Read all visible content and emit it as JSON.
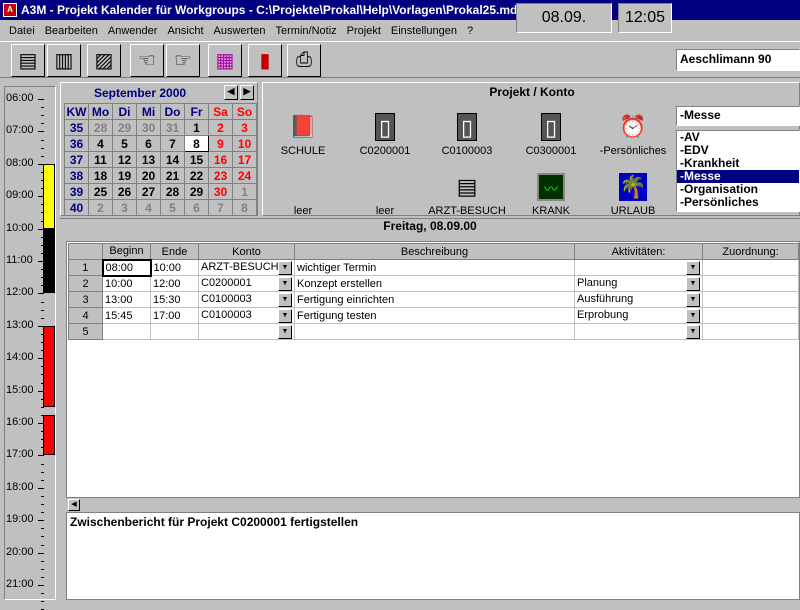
{
  "window": {
    "title": "A3M - Projekt Kalender für Workgroups - C:\\Projekte\\Prokal\\Help\\Vorlagen\\Prokal25.mdb"
  },
  "menu": [
    "Datei",
    "Bearbeiten",
    "Anwender",
    "Ansicht",
    "Auswerten",
    "Termin/Notiz",
    "Projekt",
    "Einstellungen",
    "?"
  ],
  "toolbar": {
    "buttons": [
      "notepad-icon",
      "book-icon",
      "grid-cross-icon",
      "hand-card-icon",
      "pointing-hand-icon",
      "color-grid-icon",
      "chart-icon",
      "printer-icon"
    ],
    "date": "08.09.",
    "time": "12:05",
    "user": "Aeschlimann 90"
  },
  "timeline": {
    "hours": [
      "06:00",
      "07:00",
      "08:00",
      "09:00",
      "10:00",
      "11:00",
      "12:00",
      "13:00",
      "14:00",
      "15:00",
      "16:00",
      "17:00",
      "18:00",
      "19:00",
      "20:00",
      "21:00"
    ],
    "blocks": [
      {
        "from": 8.0,
        "to": 10.0,
        "color": "#ffff00"
      },
      {
        "from": 10.0,
        "to": 12.0,
        "color": "#000000"
      },
      {
        "from": 13.0,
        "to": 15.5,
        "color": "#ff0000"
      },
      {
        "from": 15.75,
        "to": 17.0,
        "color": "#ff0000"
      }
    ]
  },
  "calendar": {
    "month": "September 2000",
    "prev": "◀",
    "next": "▶",
    "headers": [
      "KW",
      "Mo",
      "Di",
      "Mi",
      "Do",
      "Fr",
      "Sa",
      "So"
    ],
    "weeks": [
      {
        "kw": "35",
        "days": [
          "28",
          "29",
          "30",
          "31",
          "1",
          "2",
          "3"
        ]
      },
      {
        "kw": "36",
        "days": [
          "4",
          "5",
          "6",
          "7",
          "8",
          "9",
          "10"
        ]
      },
      {
        "kw": "37",
        "days": [
          "11",
          "12",
          "13",
          "14",
          "15",
          "16",
          "17"
        ]
      },
      {
        "kw": "38",
        "days": [
          "18",
          "19",
          "20",
          "21",
          "22",
          "23",
          "24"
        ]
      },
      {
        "kw": "39",
        "days": [
          "25",
          "26",
          "27",
          "28",
          "29",
          "30",
          "1"
        ]
      },
      {
        "kw": "40",
        "days": [
          "2",
          "3",
          "4",
          "5",
          "6",
          "7",
          "8"
        ]
      }
    ]
  },
  "projects": {
    "title": "Projekt / Konto",
    "items": [
      {
        "label": "SCHULE",
        "icon": "red-book-icon"
      },
      {
        "label": "C0200001",
        "icon": "notebook-icon"
      },
      {
        "label": "C0100003",
        "icon": "notebook-icon"
      },
      {
        "label": "C0300001",
        "icon": "notebook-icon"
      },
      {
        "label": "-Persönliches",
        "icon": "alarm-clock-icon"
      },
      {
        "label": "leer",
        "icon": ""
      },
      {
        "label": "leer",
        "icon": ""
      },
      {
        "label": "ARZT-BESUCH",
        "icon": "stack-icon"
      },
      {
        "label": "KRANK",
        "icon": "monitor-icon"
      },
      {
        "label": "URLAUB",
        "icon": "beach-icon"
      }
    ],
    "selected_category": "-Messe",
    "categories": [
      "-AV",
      "-EDV",
      "-Krankheit",
      "-Messe",
      "-Organisation",
      "-Persönliches"
    ]
  },
  "day": {
    "title": "Freitag, 08.09.00"
  },
  "grid": {
    "columns": [
      "",
      "Beginn",
      "Ende",
      "Konto",
      "Beschreibung",
      "Aktivitäten:",
      "Zuordnung:"
    ],
    "rows": [
      {
        "n": "1",
        "beginn": "08:00",
        "ende": "10:00",
        "konto": "ARZT-BESUCH",
        "beschreibung": "wichtiger Termin",
        "aktivitaet": ""
      },
      {
        "n": "2",
        "beginn": "10:00",
        "ende": "12:00",
        "konto": "C0200001",
        "beschreibung": "Konzept erstellen",
        "aktivitaet": "Planung"
      },
      {
        "n": "3",
        "beginn": "13:00",
        "ende": "15:30",
        "konto": "C0100003",
        "beschreibung": "Fertigung einrichten",
        "aktivitaet": "Ausführung"
      },
      {
        "n": "4",
        "beginn": "15:45",
        "ende": "17:00",
        "konto": "C0100003",
        "beschreibung": "Fertigung testen",
        "aktivitaet": "Erprobung"
      },
      {
        "n": "5",
        "beginn": "",
        "ende": "",
        "konto": "",
        "beschreibung": "",
        "aktivitaet": ""
      }
    ]
  },
  "note": {
    "text": "Zwischenbericht für Projekt C0200001 fertigstellen"
  }
}
